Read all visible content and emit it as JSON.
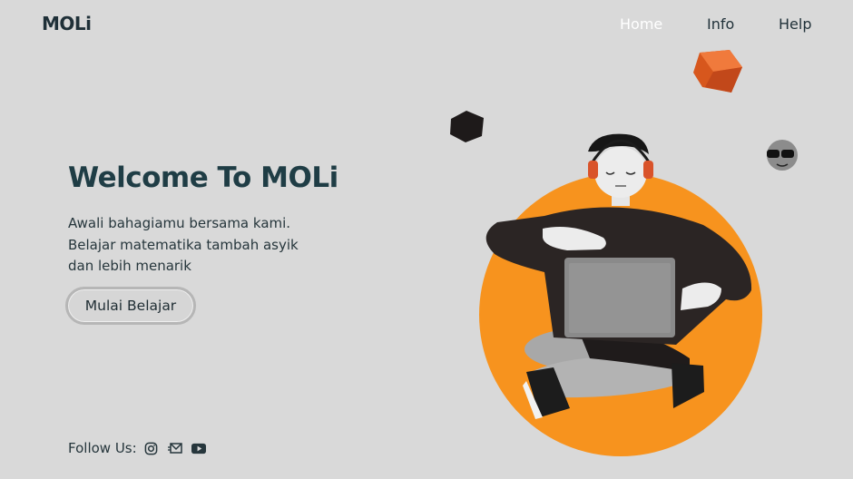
{
  "brand": {
    "logo": "MOLi"
  },
  "nav": {
    "items": [
      {
        "label": "Home",
        "active": true
      },
      {
        "label": "Info",
        "active": false
      },
      {
        "label": "Help",
        "active": false
      }
    ]
  },
  "hero": {
    "title": "Welcome To MOLi",
    "description_lines": [
      "Awali bahagiamu bersama kami.",
      "Belajar matematika tambah asyik",
      "dan lebih menarik"
    ],
    "cta_label": "Mulai Belajar"
  },
  "footer": {
    "follow_label": "Follow Us:",
    "social_icons": [
      "instagram-icon",
      "mail-icon",
      "youtube-icon"
    ]
  },
  "colors": {
    "background": "#d9d9d9",
    "accent_orange": "#f7931e",
    "dark_text": "#1f3d45",
    "active_nav": "#ffffff"
  }
}
